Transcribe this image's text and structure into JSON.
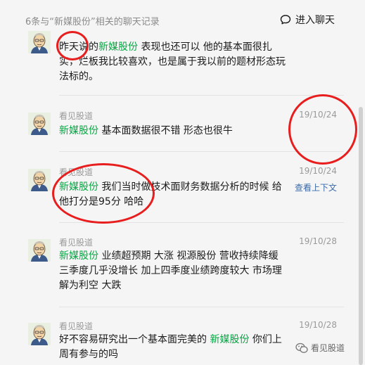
{
  "header": {
    "title": "6条与“新媒股份”相关的聊天记录",
    "enter_chat_label": "进入聊天",
    "enter_chat_icon": "chat-bubble-icon"
  },
  "messages": [
    {
      "sender": "",
      "date": "",
      "segments": [
        {
          "text": "昨天说的",
          "highlight": false
        },
        {
          "text": "新媒股份",
          "highlight": true
        },
        {
          "text": " 表现也还可以  他的基本面很扎实，烂板我比较喜欢，也是属于我以前的题材形态玩法标的。",
          "highlight": false
        }
      ]
    },
    {
      "sender": "看见股道",
      "date": "19/10/24",
      "segments": [
        {
          "text": "新媒股份",
          "highlight": true
        },
        {
          "text": " 基本面数据很不错  形态也很牛",
          "highlight": false
        }
      ]
    },
    {
      "sender": "看见股道",
      "date": "19/10/24",
      "context_link": "查看上下文",
      "segments": [
        {
          "text": "新媒股份",
          "highlight": true
        },
        {
          "text": "  我们当时做技术面财务数据分析的时候 给他打分是95分 哈哈",
          "highlight": false
        }
      ]
    },
    {
      "sender": "看见股道",
      "date": "19/10/28",
      "segments": [
        {
          "text": "新媒股份",
          "highlight": true
        },
        {
          "text": " 业绩超预期  大涨   视源股份 营收持续降缓  三季度几乎没增长  加上四季度业绩跨度较大  市场理解为利空  大跌",
          "highlight": false
        }
      ]
    },
    {
      "sender": "看见股道",
      "date": "19/10/28",
      "segments": [
        {
          "text": "好不容易研究出一个基本面完美的 ",
          "highlight": false
        },
        {
          "text": "新媒股份",
          "highlight": true
        },
        {
          "text": " 你们上周有参与的吗",
          "highlight": false
        }
      ]
    }
  ],
  "watermark": {
    "label": "看见股道",
    "icon": "wechat-logo-icon"
  },
  "colors": {
    "highlight": "#07a543",
    "annotation_ring": "#e81e1e",
    "link": "#3a6aa8",
    "background": "#f5f5f5"
  }
}
